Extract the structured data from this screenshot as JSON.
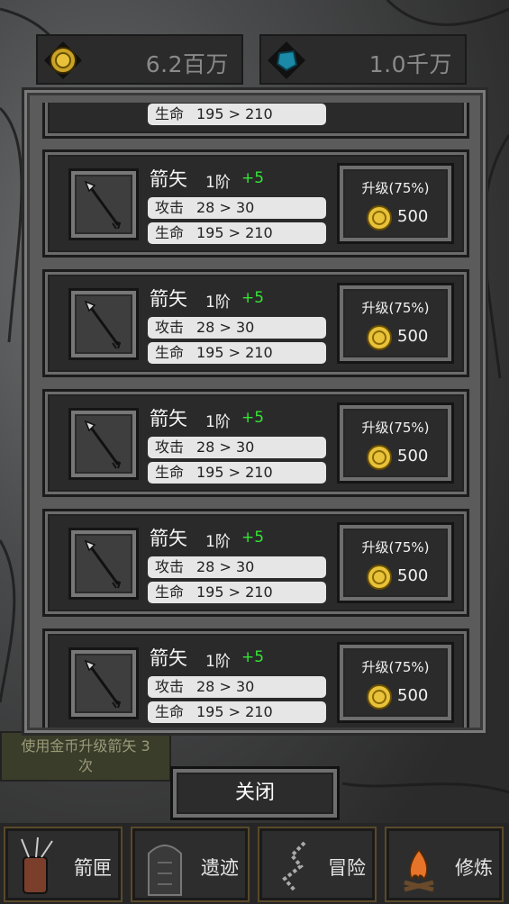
{
  "currency": {
    "gold": {
      "icon": "gold-coin-icon",
      "value": "6.2百万"
    },
    "gem": {
      "icon": "blue-gem-icon",
      "value": "1.0千万"
    }
  },
  "modal": {
    "partial_card": {
      "hp_label": "生命",
      "hp_value": "195 > 210"
    },
    "items": [
      {
        "name": "箭矢",
        "tier": "1阶",
        "plus": "+5",
        "atk_label": "攻击",
        "atk_value": "28 > 30",
        "hp_label": "生命",
        "hp_value": "195 > 210",
        "upgrade_label": "升级(75%)",
        "cost": "500"
      },
      {
        "name": "箭矢",
        "tier": "1阶",
        "plus": "+5",
        "atk_label": "攻击",
        "atk_value": "28 > 30",
        "hp_label": "生命",
        "hp_value": "195 > 210",
        "upgrade_label": "升级(75%)",
        "cost": "500"
      },
      {
        "name": "箭矢",
        "tier": "1阶",
        "plus": "+5",
        "atk_label": "攻击",
        "atk_value": "28 > 30",
        "hp_label": "生命",
        "hp_value": "195 > 210",
        "upgrade_label": "升级(75%)",
        "cost": "500"
      },
      {
        "name": "箭矢",
        "tier": "1阶",
        "plus": "+5",
        "atk_label": "攻击",
        "atk_value": "28 > 30",
        "hp_label": "生命",
        "hp_value": "195 > 210",
        "upgrade_label": "升级(75%)",
        "cost": "500"
      },
      {
        "name": "箭矢",
        "tier": "1阶",
        "plus": "+5",
        "atk_label": "攻击",
        "atk_value": "28 > 30",
        "hp_label": "生命",
        "hp_value": "195 > 210",
        "upgrade_label": "升级(75%)",
        "cost": "500"
      }
    ],
    "close_label": "关闭"
  },
  "quest": {
    "text_line1": "使用金币升级箭矢 3",
    "text_line2": "次"
  },
  "nav": {
    "items": [
      {
        "label": "箭匣",
        "icon": "quiver-icon"
      },
      {
        "label": "遗迹",
        "icon": "ruins-icon"
      },
      {
        "label": "冒险",
        "icon": "path-icon"
      },
      {
        "label": "修炼",
        "icon": "campfire-icon"
      }
    ]
  },
  "colors": {
    "plus_green": "#35e335",
    "gold": "#e8c23a",
    "gem": "#1a8aa8"
  }
}
